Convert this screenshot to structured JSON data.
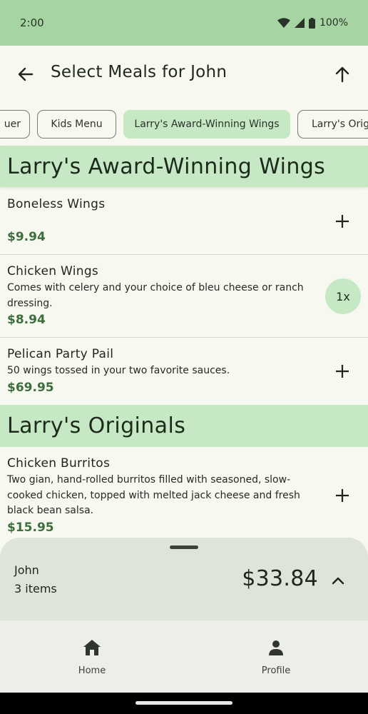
{
  "status": {
    "time": "2:00",
    "battery": "100%"
  },
  "app_bar": {
    "title": "Select Meals for John"
  },
  "chips": [
    {
      "label": "uer",
      "selected": false
    },
    {
      "label": "Kids Menu",
      "selected": false
    },
    {
      "label": "Larry's Award-Winning Wings",
      "selected": true
    },
    {
      "label": "Larry's Origi",
      "selected": false
    }
  ],
  "sections": [
    {
      "title": "Larry's Award-Winning Wings",
      "items": [
        {
          "name": "Boneless Wings",
          "description": "",
          "price": "$9.94",
          "quantity": ""
        },
        {
          "name": "Chicken Wings",
          "description": "Comes with celery and your choice of bleu cheese or ranch dressing.",
          "price": "$8.94",
          "quantity": "1x"
        },
        {
          "name": "Pelican Party Pail",
          "description": "50 wings tossed in your two favorite sauces.",
          "price": "$69.95",
          "quantity": ""
        }
      ]
    },
    {
      "title": "Larry's Originals",
      "items": [
        {
          "name": "Chicken Burritos",
          "description": "Two gian, hand-rolled burritos filled with seasoned, slow-cooked chicken, topped with melted jack cheese and fresh black bean salsa.",
          "price": "$15.95",
          "quantity": ""
        }
      ]
    }
  ],
  "cart": {
    "name": "John",
    "count": "3 items",
    "total": "$33.84"
  },
  "nav": [
    {
      "label": "Home",
      "icon": "home-icon"
    },
    {
      "label": "Profile",
      "icon": "person-icon"
    }
  ],
  "colors": {
    "accent": "#c6e8c4",
    "status_bar": "#a6d5a3",
    "price": "#3e6e3d",
    "background": "#f7f9f1"
  }
}
